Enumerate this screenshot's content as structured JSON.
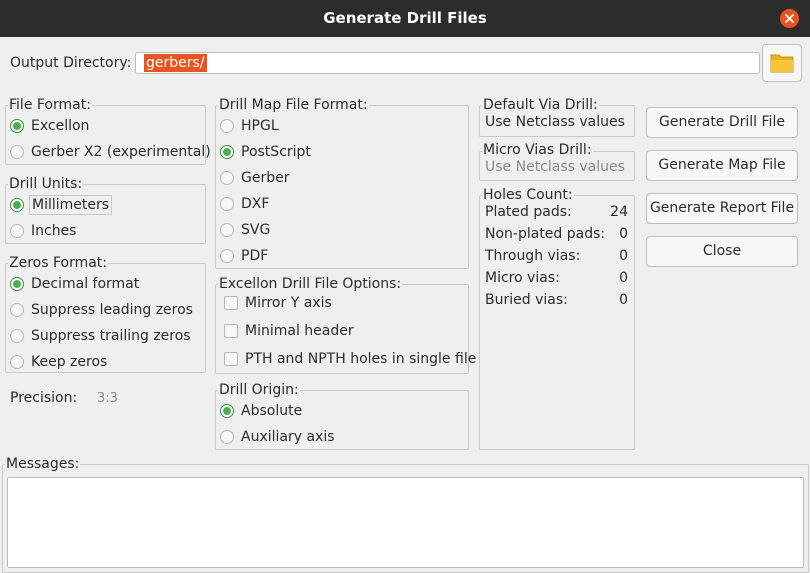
{
  "window": {
    "title": "Generate Drill Files"
  },
  "output": {
    "label": "Output Directory:",
    "value": "gerbers/",
    "folder_icon": "folder-icon"
  },
  "file_format": {
    "label": "File Format:",
    "options": [
      "Excellon",
      "Gerber X2 (experimental)"
    ],
    "selected": "Excellon"
  },
  "drill_units": {
    "label": "Drill Units:",
    "options": [
      "Millimeters",
      "Inches"
    ],
    "selected": "Millimeters"
  },
  "zeros_format": {
    "label": "Zeros Format:",
    "options": [
      "Decimal format",
      "Suppress leading zeros",
      "Suppress trailing zeros",
      "Keep zeros"
    ],
    "selected": "Decimal format"
  },
  "precision": {
    "label": "Precision:",
    "value": "3:3"
  },
  "drill_map": {
    "label": "Drill Map File Format:",
    "options": [
      "HPGL",
      "PostScript",
      "Gerber",
      "DXF",
      "SVG",
      "PDF"
    ],
    "selected": "PostScript"
  },
  "excellon_options": {
    "label": "Excellon Drill File Options:",
    "options": [
      "Mirror Y axis",
      "Minimal header",
      "PTH and NPTH holes in single file"
    ]
  },
  "drill_origin": {
    "label": "Drill Origin:",
    "options": [
      "Absolute",
      "Auxiliary axis"
    ],
    "selected": "Absolute"
  },
  "default_via": {
    "label": "Default Via Drill:",
    "value": "Use Netclass values"
  },
  "micro_via": {
    "label": "Micro Vias Drill:",
    "value": "Use Netclass values"
  },
  "holes_count": {
    "label": "Holes Count:",
    "rows": [
      {
        "label": "Plated pads:",
        "value": "24"
      },
      {
        "label": "Non-plated pads:",
        "value": "0"
      },
      {
        "label": "Through vias:",
        "value": "0"
      },
      {
        "label": "Micro vias:",
        "value": "0"
      },
      {
        "label": "Buried vias:",
        "value": "0"
      }
    ]
  },
  "buttons": {
    "generate_drill": "Generate Drill File",
    "generate_map": "Generate Map File",
    "generate_report": "Generate Report File",
    "close": "Close"
  },
  "messages": {
    "label": "Messages:"
  },
  "colors": {
    "accent": "#e95420",
    "radio_on": "#4caf50",
    "titlebar": "#2c2c2c"
  }
}
